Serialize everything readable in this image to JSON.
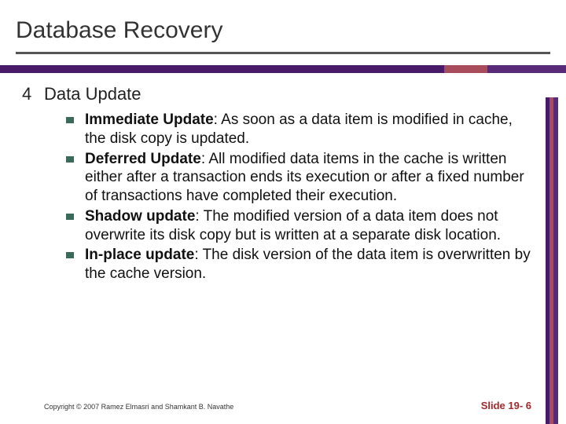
{
  "title": "Database Recovery",
  "section": {
    "number": "4",
    "heading": "Data Update"
  },
  "bullets": [
    {
      "term": "Immediate Update",
      "rest": ":  As soon as a data item is modified in cache, the disk copy is updated."
    },
    {
      "term": "Deferred Update",
      "rest": ":  All modified data items in the cache is written either after a transaction ends its execution or after a fixed number of transactions have completed their execution."
    },
    {
      "term": "Shadow update",
      "rest": ":  The modified version of a data item does not overwrite its disk copy but is written at a separate disk location."
    },
    {
      "term": "In-place update",
      "rest": ": The disk version of the data item is overwritten by the cache version."
    }
  ],
  "footer": {
    "copyright": "Copyright © 2007 Ramez Elmasri and Shamkant B. Navathe",
    "slide": "Slide 19- 6"
  }
}
